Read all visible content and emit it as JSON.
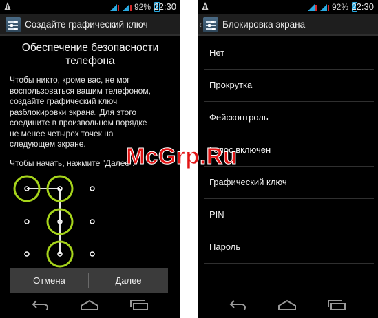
{
  "left_screen": {
    "status": {
      "battery_pct": "92%",
      "time": "22:30"
    },
    "action_bar": {
      "title": "Создайте графический ключ"
    },
    "heading": "Обеспечение безопасности телефона",
    "description": "Чтобы никто, кроме вас, не мог\nвоспользоваться вашим телефоном,\nсоздайте графический ключ\nразблокировки экрана. Для этого\nсоедините в произвольном порядке\nне менее четырех точек на\nследующем экране.",
    "start_text": "Чтобы начать, нажмите \"Далее\".",
    "pattern": {
      "grid": "3x3",
      "selected_dots": [
        1,
        2,
        5,
        8
      ],
      "path_color": "#ffffff",
      "ring_color": "#a6d41b"
    },
    "buttons": {
      "cancel": "Отмена",
      "next": "Далее"
    }
  },
  "right_screen": {
    "status": {
      "battery_pct": "92%",
      "time": "22:30"
    },
    "action_bar": {
      "title": "Блокировка экрана"
    },
    "options": [
      {
        "label": "Нет"
      },
      {
        "label": "Прокрутка"
      },
      {
        "label": "Фейсконтроль"
      },
      {
        "label": "Голос включен"
      },
      {
        "label": "Графический ключ"
      },
      {
        "label": "PIN"
      },
      {
        "label": "Пароль"
      }
    ]
  },
  "navigation": [
    "back-icon",
    "home-icon",
    "recent-apps-icon"
  ],
  "watermark": "McGrp.Ru",
  "colors": {
    "accent": "#2aa9e0",
    "pattern_ring": "#a6d41b",
    "watermark": "#e21414"
  }
}
